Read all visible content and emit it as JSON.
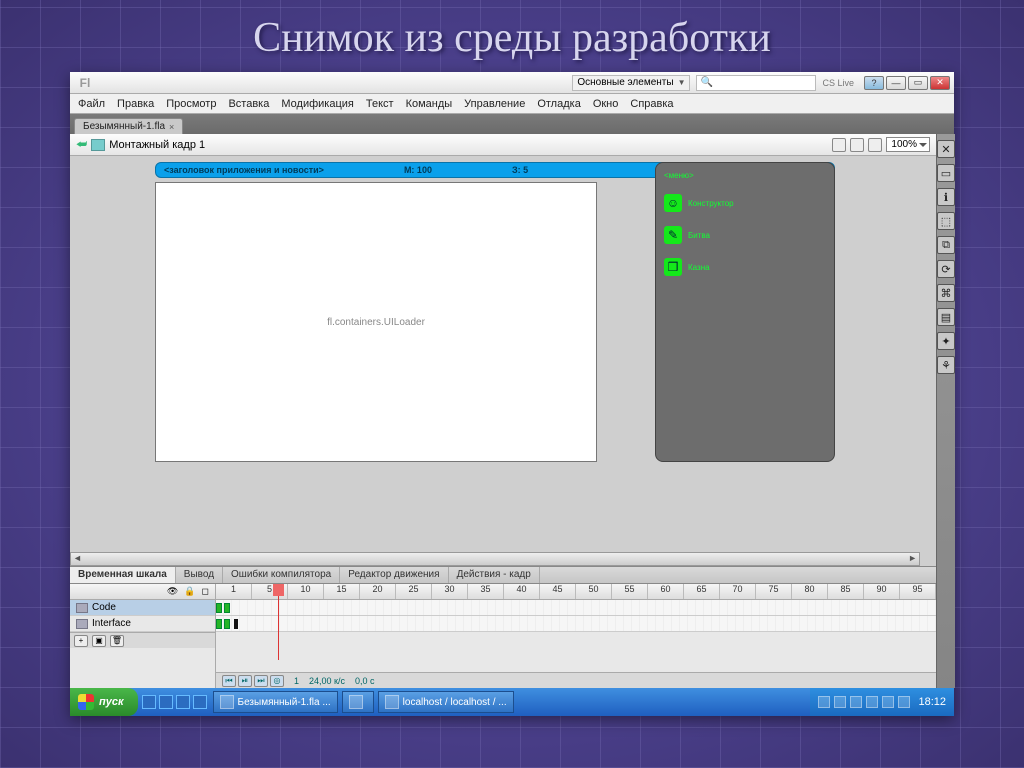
{
  "slide_title": "Снимок из среды разработки",
  "titlebar": {
    "app_hint": "Fl",
    "workspace": "Основные элементы",
    "cs_link": "CS Live",
    "search_placeholder": ""
  },
  "menubar": [
    "Файл",
    "Правка",
    "Просмотр",
    "Вставка",
    "Модификация",
    "Текст",
    "Команды",
    "Управление",
    "Отладка",
    "Окно",
    "Справка"
  ],
  "doctab": {
    "label": "Безымянный-1.fla"
  },
  "scene": {
    "name": "Монтажный кадр 1",
    "zoom": "100%"
  },
  "preview": {
    "header": "<заголовок приложения и новости>",
    "money": "М: 100",
    "health": "З: 5",
    "loader": "fl.containers.UILoader",
    "panel_title": "<меню>",
    "items": [
      {
        "icon": "☺",
        "label": "Конструктор"
      },
      {
        "icon": "✎",
        "label": "Битва"
      },
      {
        "icon": "❒",
        "label": "Казна"
      }
    ]
  },
  "bottom_tabs": [
    "Временная шкала",
    "Вывод",
    "Ошибки компилятора",
    "Редактор движения",
    "Действия - кадр"
  ],
  "timeline": {
    "ruler": [
      "1",
      "5",
      "10",
      "15",
      "20",
      "25",
      "30",
      "35",
      "40",
      "45",
      "50",
      "55",
      "60",
      "65",
      "70",
      "75",
      "80",
      "85",
      "90",
      "95"
    ],
    "layers": [
      {
        "name": "Code"
      },
      {
        "name": "Interface"
      }
    ],
    "status": {
      "frame": "1",
      "fps": "24,00 к/с",
      "time": "0,0 с"
    }
  },
  "right_tools": [
    "✕",
    "▭",
    "ℹ",
    "⬚",
    "⧉",
    "⟳",
    "⌘",
    "▤",
    "✦",
    "⚘"
  ],
  "taskbar": {
    "start": "пуск",
    "items": [
      {
        "icon": "Fl",
        "label": "Безымянный-1.fla ..."
      },
      {
        "icon": "☰",
        "label": ""
      },
      {
        "icon": "◐",
        "label": "localhost / localhost / ..."
      }
    ],
    "clock": "18:12"
  }
}
